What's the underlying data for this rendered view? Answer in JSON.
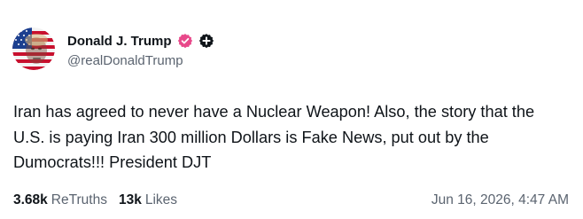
{
  "author": {
    "display_name": "Donald J. Trump",
    "handle": "@realDonaldTrump",
    "verified_badge_icon": "verified-badge-icon",
    "plus_badge_icon": "plus-badge-icon",
    "avatar_icon": "avatar-image"
  },
  "post": {
    "text": "Iran has agreed to never have a Nuclear Weapon! Also, the story that the U.S. is paying Iran 300 million Dollars is Fake News, put out by the Dumocrats!!! President DJT"
  },
  "footer": {
    "retruths_count": "3.68k",
    "retruths_label": "ReTruths",
    "likes_count": "13k",
    "likes_label": "Likes",
    "timestamp": "Jun 16, 2026, 4:47 AM"
  },
  "colors": {
    "text_primary": "#0f1419",
    "text_secondary": "#5b6470",
    "verified_badge": "#e8488a",
    "plus_badge": "#0f1419"
  }
}
